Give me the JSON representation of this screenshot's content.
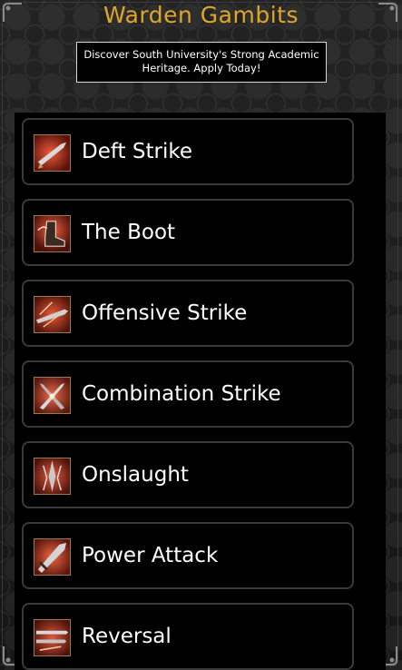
{
  "page": {
    "title": "Warden Gambits",
    "title_color": "#e0a62a"
  },
  "ad": {
    "line1": "Discover South University's Strong Academic",
    "line2": "Heritage. Apply Today!"
  },
  "gambits": [
    {
      "label": "Deft Strike",
      "icon": "deft-strike-icon"
    },
    {
      "label": "The Boot",
      "icon": "the-boot-icon"
    },
    {
      "label": "Offensive Strike",
      "icon": "offensive-strike-icon"
    },
    {
      "label": "Combination Strike",
      "icon": "combination-strike-icon"
    },
    {
      "label": "Onslaught",
      "icon": "onslaught-icon"
    },
    {
      "label": "Power Attack",
      "icon": "power-attack-icon"
    },
    {
      "label": "Reversal",
      "icon": "reversal-icon"
    }
  ]
}
